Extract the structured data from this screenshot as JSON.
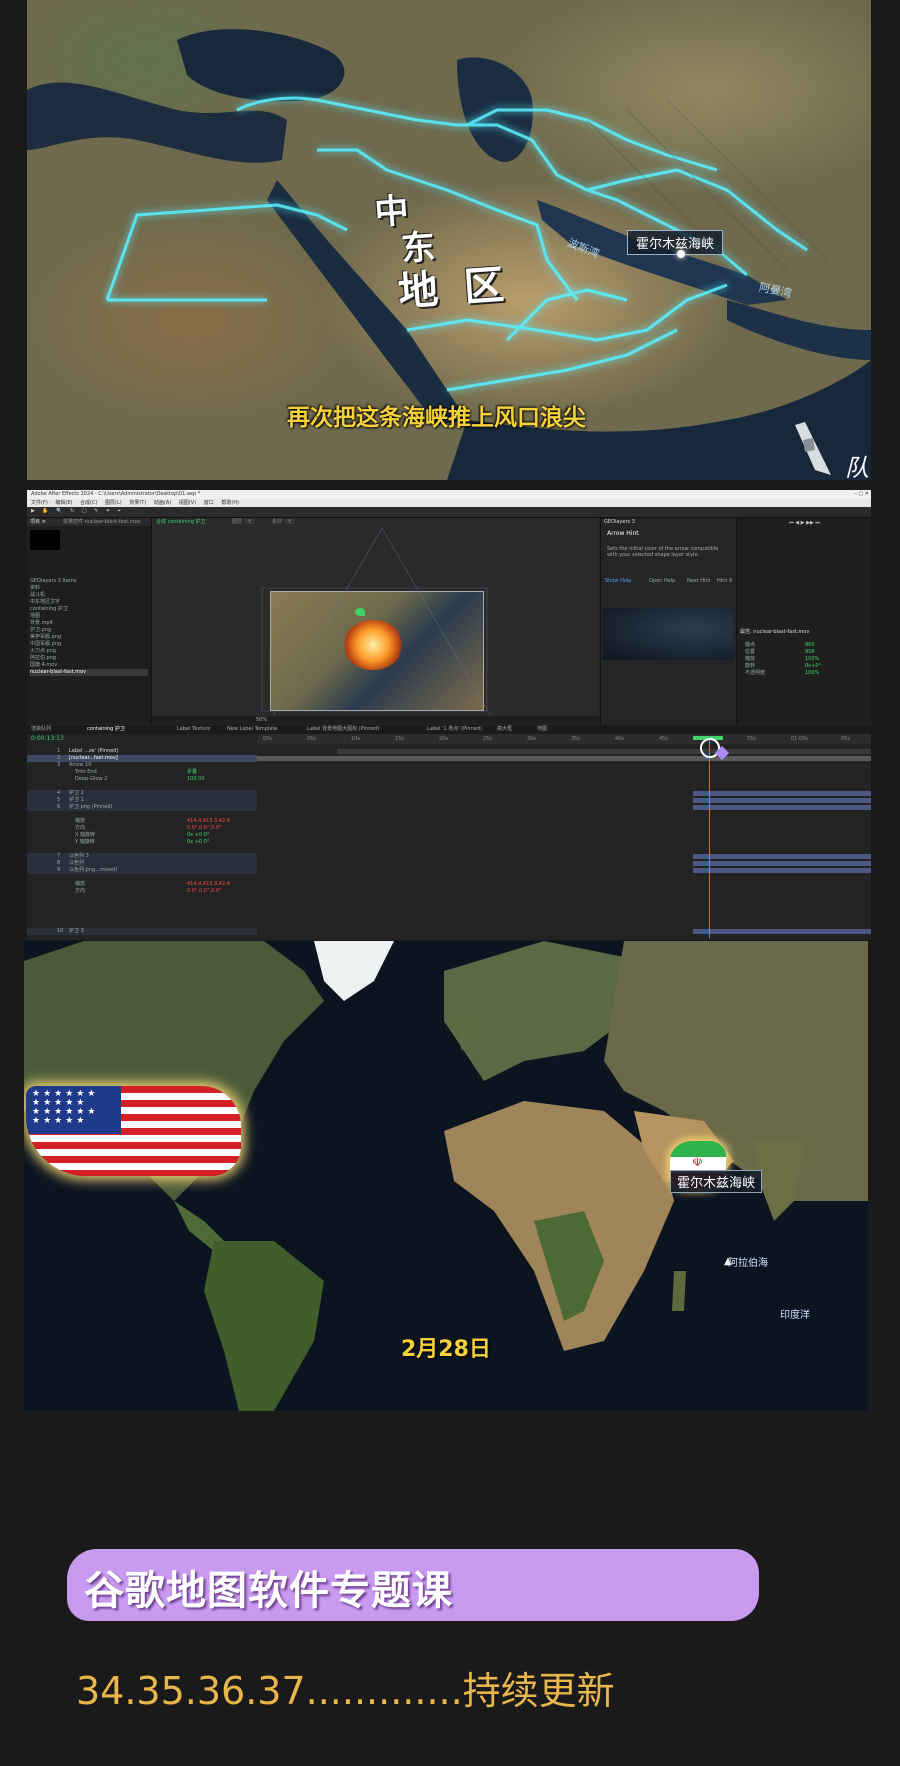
{
  "map_top": {
    "region_title_lines": [
      "中",
      "东",
      "地 区"
    ],
    "strait_label": "霍尔木兹海峡",
    "gulf_label": "波斯湾",
    "sea_label": "阿曼湾",
    "subtitle": "再次把这条海峡推上风口浪尖",
    "corner_mark": "队"
  },
  "ae": {
    "title_bar": "Adobe After Effects 2024 - C:\\Users\\Administrator\\Desktop\\01.aep *",
    "menu": [
      "文件(F)",
      "编辑(E)",
      "合成(C)",
      "图层(L)",
      "效果(T)",
      "动画(A)",
      "视图(V)",
      "窗口",
      "帮助(H)"
    ],
    "project_tab": "项目 ≡",
    "effect_tab": "效果控件 nuclear-blast-fast.mov",
    "comp_tab": "合成 containing 护卫",
    "layer_tab": "图层（无）",
    "footage_tab": "素材（无）",
    "project_items": [
      "GEOlayers 3 Items",
      "资料",
      "战斗机",
      "中东地区文字",
      "containing 护卫",
      "地图",
      "背景.mp4",
      "护卫.png",
      "美伊军舰.png",
      "中国军舰.png",
      "火力点.png",
      "阿拉伯.png",
      "国旗 4.mov",
      "nuclear-blast-fast.mov"
    ],
    "plugin_panel_title": "GEOlayers 3",
    "arrow_hint_title": "Arrow Hint",
    "arrow_hint_text": "Sets the initial color of the arrow compatible with your selected shape layer style.",
    "hint_buttons": [
      "Show Help",
      "Open Help",
      "Next Hint",
      "Hint 9"
    ],
    "right_panel_title": "属性: nuclear-blast-fast.mov",
    "right_props": [
      {
        "label": "锚点",
        "value": "960"
      },
      {
        "label": "位置",
        "value": "958"
      },
      {
        "label": "缩放",
        "value": "100%"
      },
      {
        "label": "旋转",
        "value": "0x+0°"
      },
      {
        "label": "不透明度",
        "value": "100%"
      }
    ],
    "timeline_tabs": [
      "渲染队列",
      "containing 护卫",
      "Label Texture",
      "New Label Template",
      "Label 背景地图大图标 (Pinned)",
      "Label '1 地点' (Pinned)",
      "搞大框",
      "地图"
    ],
    "timecode": "0:00:13:13",
    "zoom": "50%",
    "layers": [
      {
        "num": "1",
        "name": "Label ...ze' (Pinned)"
      },
      {
        "num": "2",
        "name": "[nuclear...fast.mov]"
      },
      {
        "num": "3",
        "name": "Arrow 10"
      },
      {
        "num": "",
        "name": "Trim End"
      },
      {
        "num": "",
        "name": "Deep-Glow 2"
      },
      {
        "num": "4",
        "name": "护卫 2"
      },
      {
        "num": "5",
        "name": "护卫 1"
      },
      {
        "num": "6",
        "name": "护卫.png (Pinned)"
      },
      {
        "num": "",
        "name": "缩放"
      },
      {
        "num": "",
        "name": "方向"
      },
      {
        "num": "",
        "name": "X 轴旋转"
      },
      {
        "num": "",
        "name": "Y 轴旋转"
      },
      {
        "num": "7",
        "name": "以色列 3"
      },
      {
        "num": "8",
        "name": "以色列"
      },
      {
        "num": "9",
        "name": "以色列.png...mixed)"
      },
      {
        "num": "",
        "name": "缩放"
      },
      {
        "num": "",
        "name": "方向"
      },
      {
        "num": "10",
        "name": "护卫 3"
      }
    ],
    "values_green": [
      "折叠",
      "100.00",
      "折叠",
      "折叠"
    ],
    "values_red": [
      "414.4,413.3,42.4",
      "0.0°,0.0°,0.0°",
      "0x +0.0°",
      "0x +0.0°"
    ],
    "ruler_ticks": [
      "00s",
      "05s",
      "10s",
      "15s",
      "20s",
      "25s",
      "30s",
      "35s",
      "40s",
      "45s",
      "50s",
      "55s",
      "01:00s",
      "05s"
    ]
  },
  "map_bottom": {
    "strait_label": "霍尔木兹海峡",
    "date": "2月28日",
    "sea_label": "阿拉伯海",
    "ocean_label": "印度洋"
  },
  "promo": {
    "title": "谷歌地图软件专题课",
    "update": "34.35.36.37.............持续更新"
  },
  "colors": {
    "glow": "#59f0ff",
    "subtitle": "#f5d23c",
    "promo_pill": "#c89bf0",
    "update_text": "#e8b64a",
    "ae_green": "#3fd36a"
  }
}
